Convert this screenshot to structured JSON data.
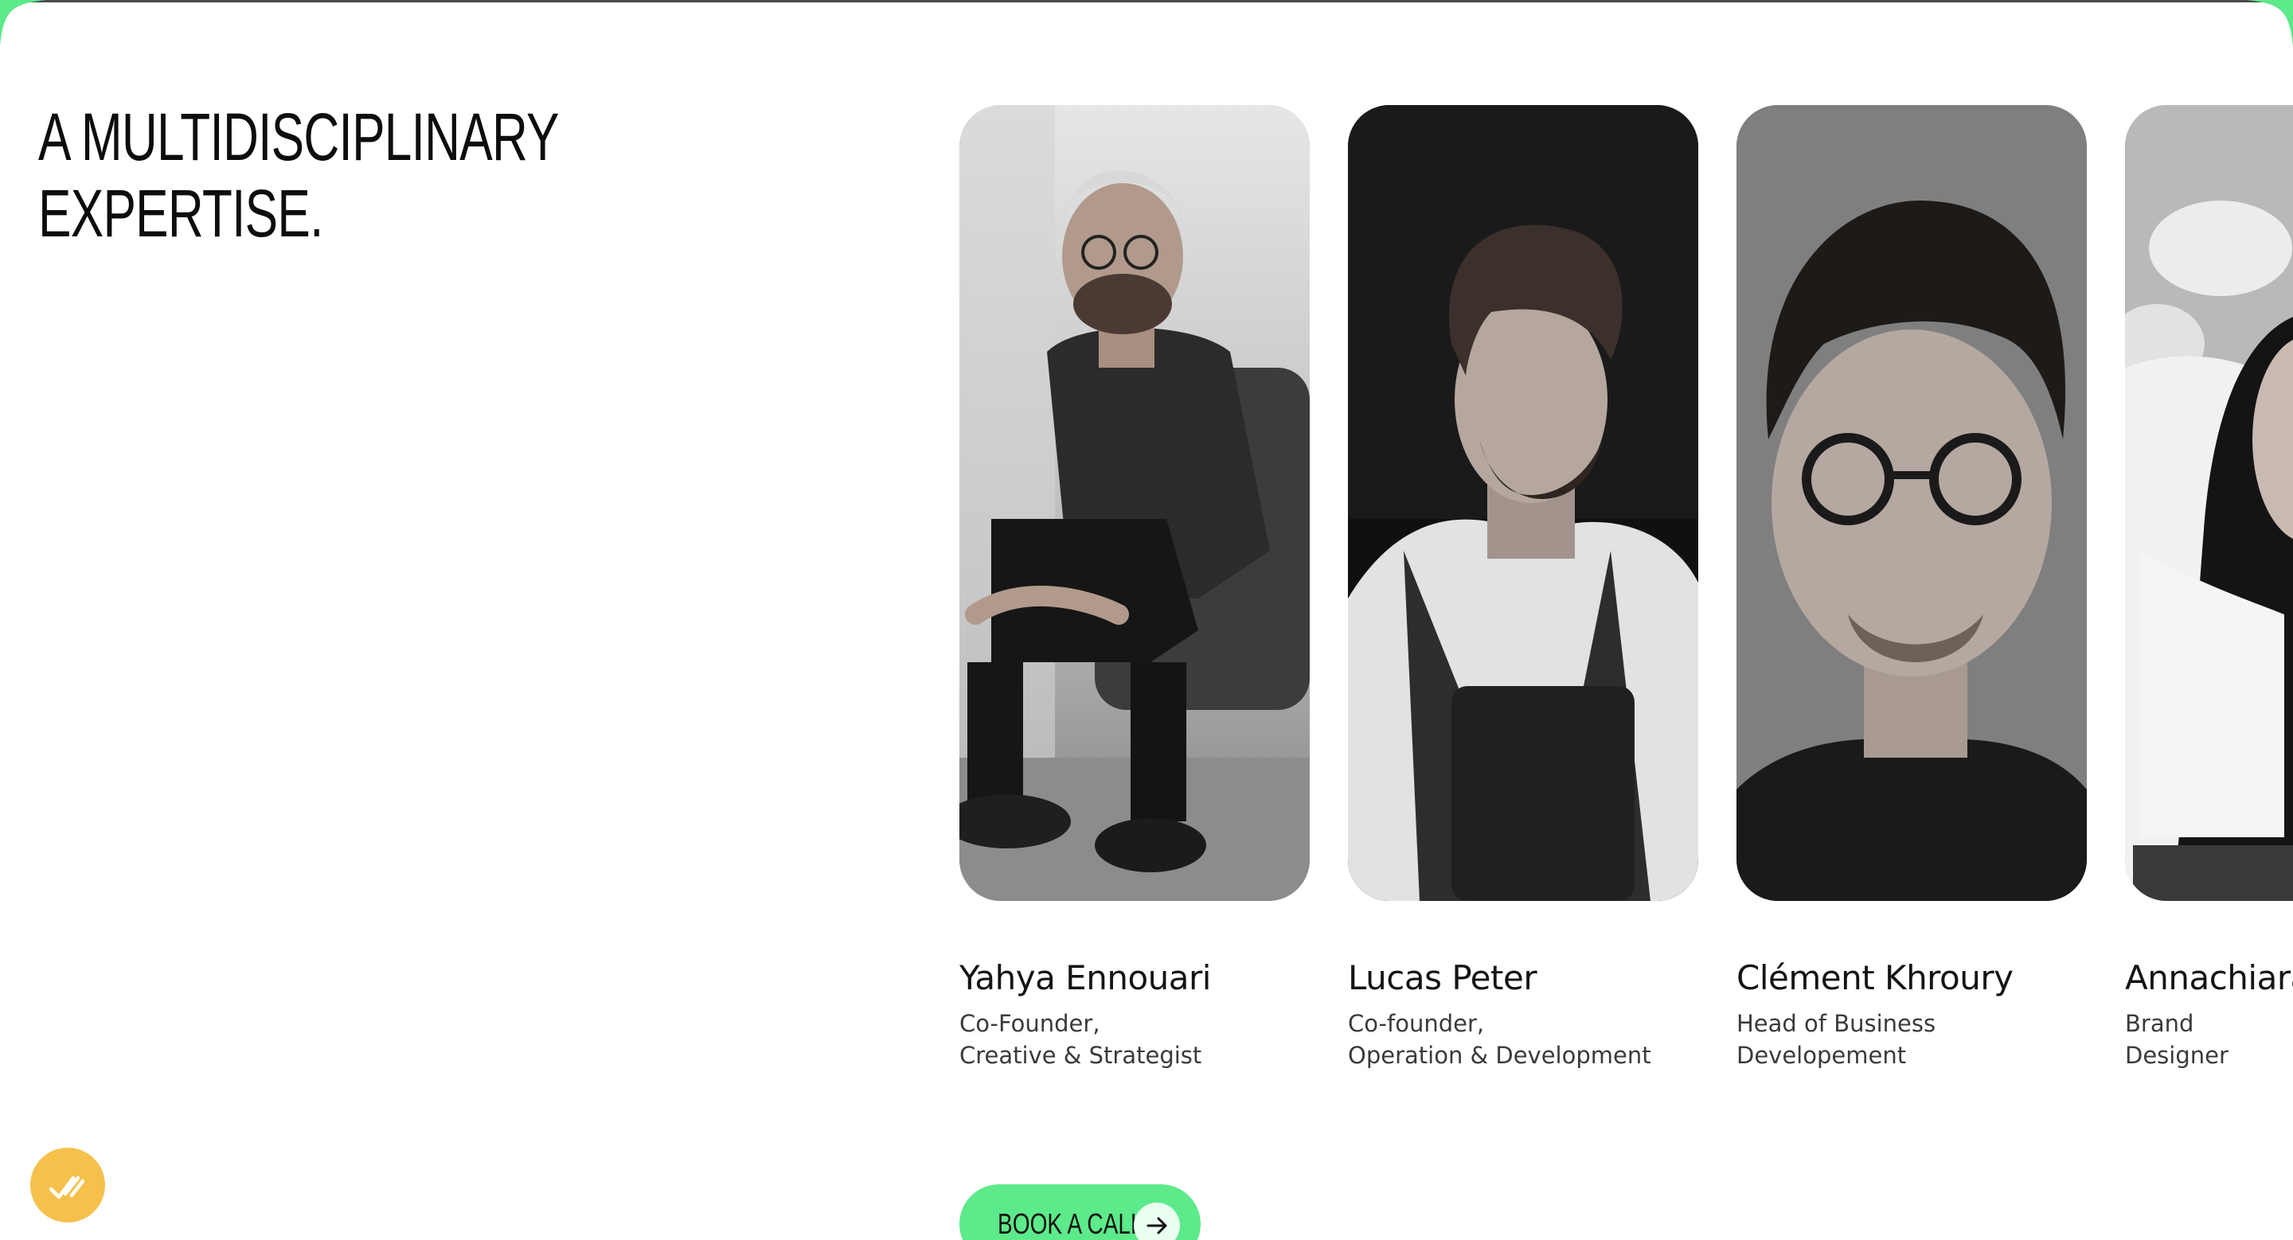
{
  "heading": {
    "line1": "A MULTIDISCIPLINARY",
    "line2": "EXPERTISE."
  },
  "team": [
    {
      "name": "Yahya Ennouari",
      "role_line1": "Co-Founder,",
      "role_line2": "Creative & Strategist",
      "photo_icon": "portrait-photo"
    },
    {
      "name": "Lucas Peter",
      "role_line1": "Co-founder,",
      "role_line2": "Operation & Development",
      "photo_icon": "portrait-photo"
    },
    {
      "name": "Clément Khroury",
      "role_line1": "Head of Business",
      "role_line2": "Developement",
      "photo_icon": "portrait-photo"
    },
    {
      "name": "Annachiara",
      "role_line1": "Brand",
      "role_line2": "Designer",
      "photo_icon": "portrait-photo"
    }
  ],
  "cta": {
    "label": "BOOK A CALL",
    "icon": "arrow-right-icon"
  },
  "badge": {
    "icon": "check-marks-icon"
  },
  "colors": {
    "accent_green": "#5cea8a",
    "badge_yellow": "#f5c14a",
    "text": "#111111",
    "background": "#ffffff"
  }
}
